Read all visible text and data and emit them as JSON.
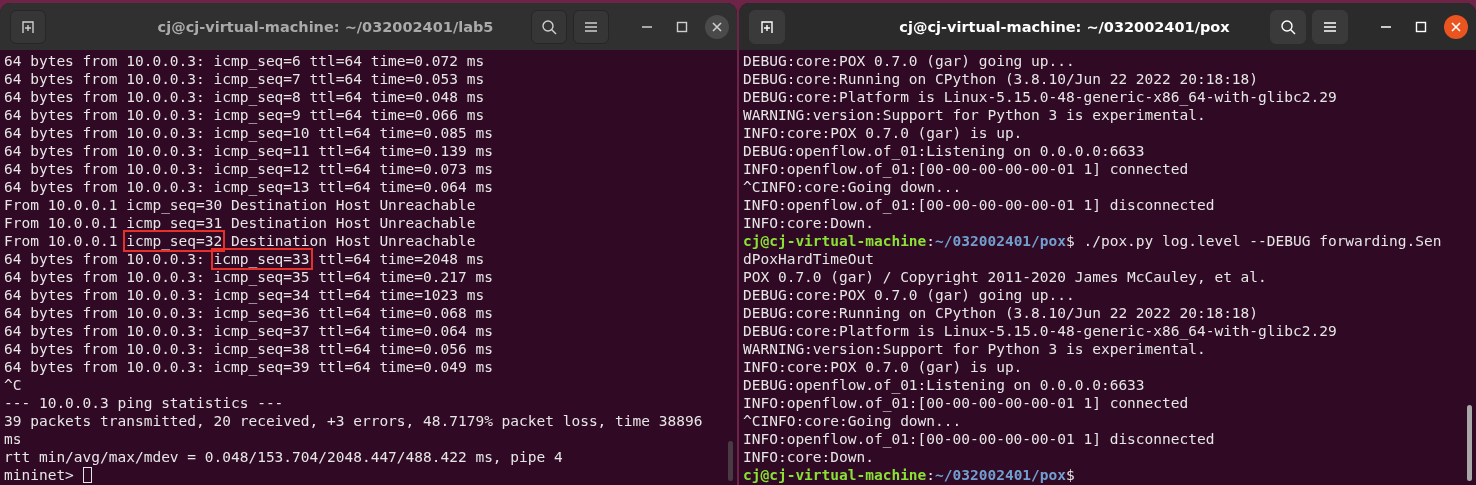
{
  "windows": [
    {
      "title": "cj@cj-virtual-machine: ~/032002401/lab5",
      "focused": false,
      "cursor": true,
      "lines": [
        {
          "text": "64 bytes from 10.0.0.3: icmp_seq=6 ttl=64 time=0.072 ms"
        },
        {
          "text": "64 bytes from 10.0.0.3: icmp_seq=7 ttl=64 time=0.053 ms"
        },
        {
          "text": "64 bytes from 10.0.0.3: icmp_seq=8 ttl=64 time=0.048 ms"
        },
        {
          "text": "64 bytes from 10.0.0.3: icmp_seq=9 ttl=64 time=0.066 ms"
        },
        {
          "text": "64 bytes from 10.0.0.3: icmp_seq=10 ttl=64 time=0.085 ms"
        },
        {
          "text": "64 bytes from 10.0.0.3: icmp_seq=11 ttl=64 time=0.139 ms"
        },
        {
          "text": "64 bytes from 10.0.0.3: icmp_seq=12 ttl=64 time=0.073 ms"
        },
        {
          "text": "64 bytes from 10.0.0.3: icmp_seq=13 ttl=64 time=0.064 ms"
        },
        {
          "text": "From 10.0.0.1 icmp_seq=30 Destination Host Unreachable"
        },
        {
          "text": "From 10.0.0.1 icmp_seq=31 Destination Host Unreachable"
        },
        {
          "segments": [
            {
              "kind": "plain",
              "text": "From 10.0.0.1 "
            },
            {
              "kind": "boxed",
              "text": "icmp_seq=32"
            },
            {
              "kind": "plain",
              "text": " Destination Host Unreachable"
            }
          ]
        },
        {
          "segments": [
            {
              "kind": "plain",
              "text": "64 bytes from 10.0.0.3: "
            },
            {
              "kind": "boxed",
              "text": "icmp_seq=33"
            },
            {
              "kind": "plain",
              "text": " ttl=64 time=2048 ms"
            }
          ]
        },
        {
          "text": "64 bytes from 10.0.0.3: icmp_seq=35 ttl=64 time=0.217 ms"
        },
        {
          "text": "64 bytes from 10.0.0.3: icmp_seq=34 ttl=64 time=1023 ms"
        },
        {
          "text": "64 bytes from 10.0.0.3: icmp_seq=36 ttl=64 time=0.068 ms"
        },
        {
          "text": "64 bytes from 10.0.0.3: icmp_seq=37 ttl=64 time=0.064 ms"
        },
        {
          "text": "64 bytes from 10.0.0.3: icmp_seq=38 ttl=64 time=0.056 ms"
        },
        {
          "text": "64 bytes from 10.0.0.3: icmp_seq=39 ttl=64 time=0.049 ms"
        },
        {
          "text": "^C"
        },
        {
          "text": "--- 10.0.0.3 ping statistics ---"
        },
        {
          "text": "39 packets transmitted, 20 received, +3 errors, 48.7179% packet loss, time 38896"
        },
        {
          "text": "ms"
        },
        {
          "text": "rtt min/avg/max/mdev = 0.048/153.704/2048.447/488.422 ms, pipe 4"
        },
        {
          "text": "mininet> "
        }
      ]
    },
    {
      "title": "cj@cj-virtual-machine: ~/032002401/pox",
      "focused": true,
      "cursor": false,
      "lines": [
        {
          "text": "DEBUG:core:POX 0.7.0 (gar) going up..."
        },
        {
          "text": "DEBUG:core:Running on CPython (3.8.10/Jun 22 2022 20:18:18)"
        },
        {
          "text": "DEBUG:core:Platform is Linux-5.15.0-48-generic-x86_64-with-glibc2.29"
        },
        {
          "text": "WARNING:version:Support for Python 3 is experimental."
        },
        {
          "text": "INFO:core:POX 0.7.0 (gar) is up."
        },
        {
          "text": "DEBUG:openflow.of_01:Listening on 0.0.0.0:6633"
        },
        {
          "text": "INFO:openflow.of_01:[00-00-00-00-00-01 1] connected"
        },
        {
          "text": "^CINFO:core:Going down..."
        },
        {
          "text": "INFO:openflow.of_01:[00-00-00-00-00-01 1] disconnected"
        },
        {
          "text": "INFO:core:Down."
        },
        {
          "segments": [
            {
              "kind": "user",
              "text": "cj@cj-virtual-machine"
            },
            {
              "kind": "plain",
              "text": ":"
            },
            {
              "kind": "path",
              "text": "~/032002401/pox"
            },
            {
              "kind": "plain",
              "text": "$ ./pox.py log.level --DEBUG forwarding.Sen"
            }
          ]
        },
        {
          "text": "dPoxHardTimeOut"
        },
        {
          "text": "POX 0.7.0 (gar) / Copyright 2011-2020 James McCauley, et al."
        },
        {
          "text": "DEBUG:core:POX 0.7.0 (gar) going up..."
        },
        {
          "text": "DEBUG:core:Running on CPython (3.8.10/Jun 22 2022 20:18:18)"
        },
        {
          "text": "DEBUG:core:Platform is Linux-5.15.0-48-generic-x86_64-with-glibc2.29"
        },
        {
          "text": "WARNING:version:Support for Python 3 is experimental."
        },
        {
          "text": "INFO:core:POX 0.7.0 (gar) is up."
        },
        {
          "text": "DEBUG:openflow.of_01:Listening on 0.0.0.0:6633"
        },
        {
          "text": "INFO:openflow.of_01:[00-00-00-00-00-01 1] connected"
        },
        {
          "text": "^CINFO:core:Going down..."
        },
        {
          "text": "INFO:openflow.of_01:[00-00-00-00-00-01 1] disconnected"
        },
        {
          "text": "INFO:core:Down."
        },
        {
          "segments": [
            {
              "kind": "user",
              "text": "cj@cj-virtual-machine"
            },
            {
              "kind": "plain",
              "text": ":"
            },
            {
              "kind": "path",
              "text": "~/032002401/pox"
            },
            {
              "kind": "plain",
              "text": "$"
            }
          ]
        }
      ]
    }
  ]
}
